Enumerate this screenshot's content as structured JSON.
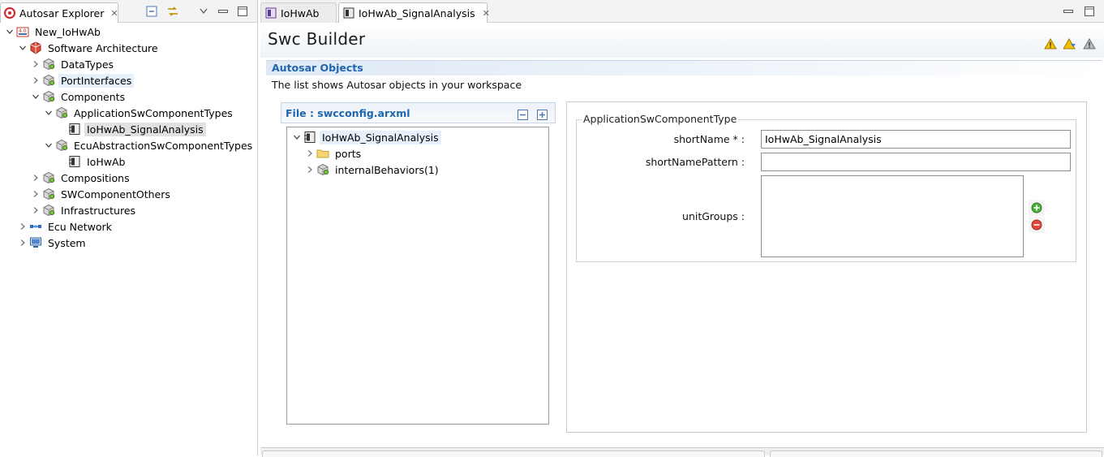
{
  "explorer": {
    "tab_label": "Autosar Explorer",
    "tree": [
      {
        "label": "New_IoHwAb",
        "icon": "project-icon",
        "level": 0,
        "state": "expanded"
      },
      {
        "label": "Software Architecture",
        "icon": "architecture-icon",
        "level": 1,
        "state": "expanded"
      },
      {
        "label": "DataTypes",
        "icon": "package-icon",
        "level": 2,
        "state": "collapsed"
      },
      {
        "label": "PortInterfaces",
        "icon": "package-icon",
        "level": 2,
        "state": "collapsed",
        "highlight": "hover"
      },
      {
        "label": "Components",
        "icon": "package-icon",
        "level": 2,
        "state": "expanded"
      },
      {
        "label": "ApplicationSwComponentTypes",
        "icon": "package-icon",
        "level": 3,
        "state": "expanded"
      },
      {
        "label": "IoHwAb_SignalAnalysis",
        "icon": "component-icon",
        "level": 4,
        "state": "leaf",
        "highlight": "selected"
      },
      {
        "label": "EcuAbstractionSwComponentTypes",
        "icon": "package-icon",
        "level": 3,
        "state": "expanded"
      },
      {
        "label": "IoHwAb",
        "icon": "component-icon",
        "level": 4,
        "state": "leaf"
      },
      {
        "label": "Compositions",
        "icon": "package-icon",
        "level": 2,
        "state": "collapsed"
      },
      {
        "label": "SWComponentOthers",
        "icon": "package-icon",
        "level": 2,
        "state": "collapsed"
      },
      {
        "label": "Infrastructures",
        "icon": "package-icon",
        "level": 2,
        "state": "collapsed"
      },
      {
        "label": "Ecu Network",
        "icon": "network-icon",
        "level": 1,
        "state": "collapsed"
      },
      {
        "label": "System",
        "icon": "system-icon",
        "level": 1,
        "state": "collapsed"
      }
    ]
  },
  "editor": {
    "tabs": [
      {
        "label": "IoHwAb",
        "active": false
      },
      {
        "label": "IoHwAb_SignalAnalysis",
        "active": true
      }
    ],
    "form_title": "Swc Builder",
    "section_title": "Autosar Objects",
    "section_description": "The list shows Autosar objects in your workspace",
    "file_label": "File : swcconfig.arxml",
    "object_tree": [
      {
        "label": "IoHwAb_SignalAnalysis",
        "icon": "component-icon",
        "level": 0,
        "state": "expanded",
        "selected": true
      },
      {
        "label": "ports",
        "icon": "folder-icon",
        "level": 1,
        "state": "collapsed"
      },
      {
        "label": "internalBehaviors(1)",
        "icon": "package-icon",
        "level": 1,
        "state": "collapsed"
      }
    ],
    "details": {
      "group_title": "ApplicationSwComponentType",
      "short_name_label": "shortName * :",
      "short_name_value": "IoHwAb_SignalAnalysis",
      "short_name_pattern_label": "shortNamePattern :",
      "short_name_pattern_value": "",
      "unit_groups_label": "unitGroups :",
      "unit_groups": []
    }
  },
  "colors": {
    "section_title": "#1e66b0",
    "selection": "#e1e1e1",
    "hover": "#e5f0fb",
    "warning": "#f2c200"
  }
}
